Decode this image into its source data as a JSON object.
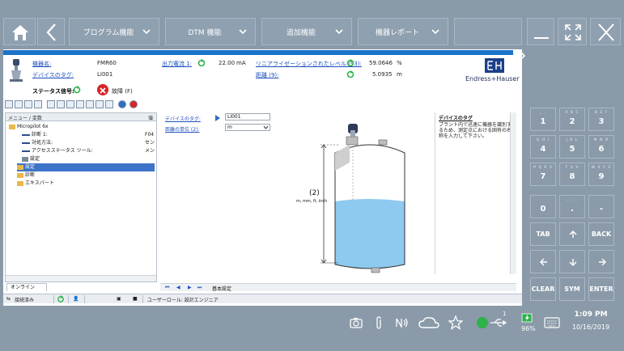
{
  "toolbar": {
    "menus": [
      {
        "label": "プログラム機能"
      },
      {
        "label": "DTM 機能"
      },
      {
        "label": "追加機能"
      },
      {
        "label": "機器レポート"
      }
    ]
  },
  "header": {
    "device_name_label": "機器名:",
    "device_name_value": "FMR60",
    "device_tag_label": "デバイスのタグ:",
    "device_tag_value": "LI001",
    "status_label": "ステータス信号:",
    "status_value": "故障 (F)",
    "output_current_label": "出力電流 1:",
    "output_current_value": "22.00",
    "output_current_unit": "mA",
    "linearized_label": "リニアライゼーションされたレベル (93):",
    "linearized_value": "59.0646",
    "linearized_unit": "%",
    "distance_label": "距離 (9):",
    "distance_value": "5.0935",
    "distance_unit": "m",
    "brand": "Endress+Hauser"
  },
  "tree": {
    "col_menu": "メニュー / 変数",
    "col_value": "値",
    "items": [
      {
        "label": "Micropilot 6x",
        "value": ""
      },
      {
        "label": "診断 1:",
        "value": "F04"
      },
      {
        "label": "対処方法:",
        "value": "セン"
      },
      {
        "label": "アクセスステータス ツール:",
        "value": "メン"
      },
      {
        "label": "設定",
        "value": ""
      },
      {
        "label": "設定",
        "value": ""
      },
      {
        "label": "診断",
        "value": ""
      },
      {
        "label": "エキスパート",
        "value": ""
      }
    ],
    "online_tab": "オンライン"
  },
  "form": {
    "tag_label": "デバイスのタグ:",
    "tag_value": "LI001",
    "unit_label": "距離の単位 (2):",
    "unit_value": "m"
  },
  "diagram": {
    "callout": "(2)",
    "units_text": "m, mm, ft, inch"
  },
  "help": {
    "title": "デバイスのタグ",
    "body": "プラント内で迅速に機器を識別するため、測定点における固有の名称を入力して下さい。"
  },
  "nav": {
    "label": "基本設定"
  },
  "statusbar": {
    "connection": "接続済み",
    "user_role": "ユーザーロール: 設計エンジニア"
  },
  "keypad": {
    "keys": [
      {
        "sub": "_ .",
        "main": "1"
      },
      {
        "sub": "A B C",
        "main": "2"
      },
      {
        "sub": "D E F",
        "main": "3"
      },
      {
        "sub": "G H I",
        "main": "4"
      },
      {
        "sub": "J K L",
        "main": "5"
      },
      {
        "sub": "M N O",
        "main": "6"
      },
      {
        "sub": "P Q R S",
        "main": "7"
      },
      {
        "sub": "T U V",
        "main": "8"
      },
      {
        "sub": "W X Y Z",
        "main": "9"
      },
      {
        "sub": "",
        "main": "0"
      },
      {
        "sub": ", : ;",
        "main": "."
      },
      {
        "sub": "",
        "main": "-"
      }
    ],
    "tab": "TAB",
    "back": "BACK",
    "clear": "CLEAR",
    "sym": "SYM",
    "enter": "ENTER"
  },
  "taskbar": {
    "usb_count": "1",
    "battery": "96%",
    "time": "1:09 PM",
    "date": "10/16/2019"
  },
  "colors": {
    "accent": "#1a73c8",
    "chrome": "#8a9aa9",
    "fault": "#d6242a",
    "ok": "#2db34a",
    "water": "#8ecaf0"
  }
}
